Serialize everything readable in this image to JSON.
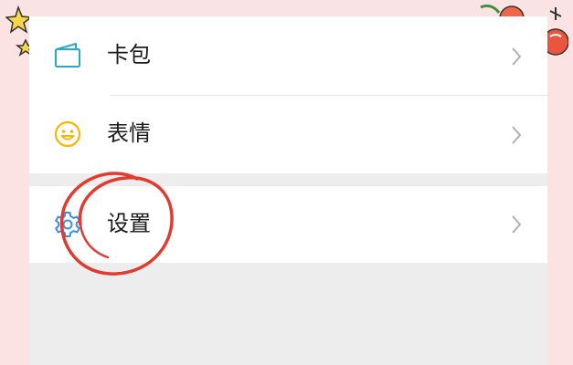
{
  "menu": {
    "items": [
      {
        "label": "卡包",
        "icon": "card-wallet-icon"
      },
      {
        "label": "表情",
        "icon": "smiley-icon"
      },
      {
        "label": "设置",
        "icon": "gear-icon"
      }
    ]
  },
  "colors": {
    "background": "#fbe3e4",
    "panel": "#ededed",
    "card_icon": "#2aa6c9",
    "smiley_icon": "#f5b800",
    "gear_icon": "#3a8ee6",
    "annotation": "#e03b2e"
  }
}
